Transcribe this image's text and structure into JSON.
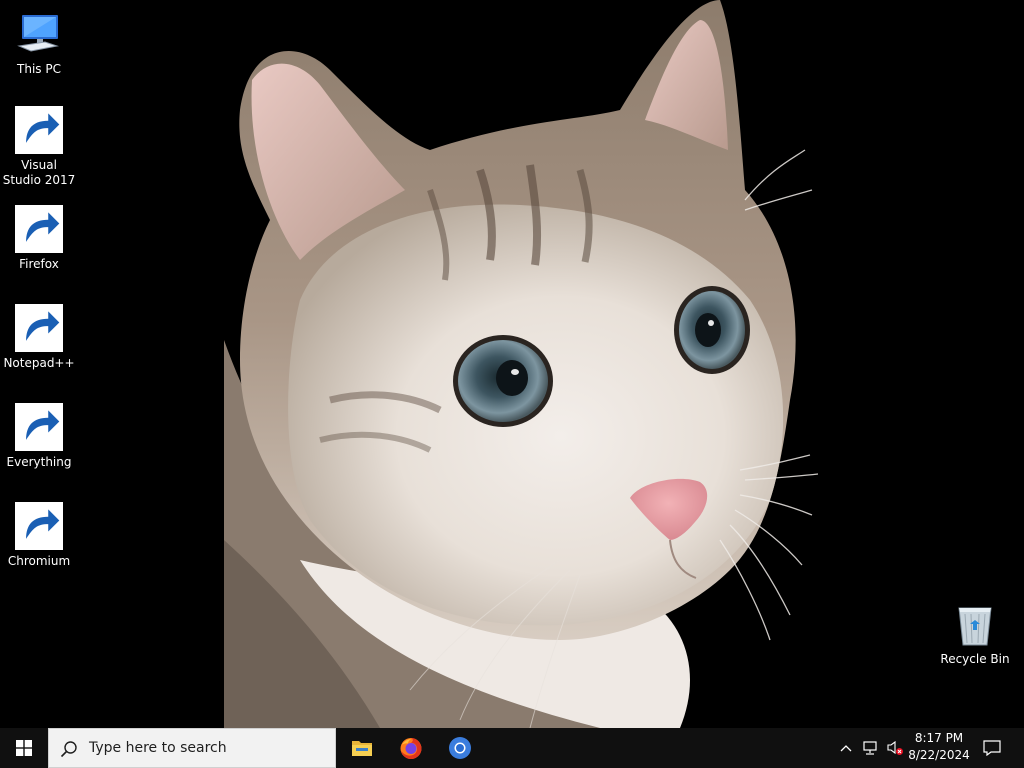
{
  "desktop": {
    "icons": [
      {
        "label": "This PC",
        "icon": "computer-icon"
      },
      {
        "label": "Visual Studio 2017",
        "icon": "visual-studio-icon"
      },
      {
        "label": "Firefox",
        "icon": "firefox-icon"
      },
      {
        "label": "Notepad++",
        "icon": "notepadpp-icon"
      },
      {
        "label": "Everything",
        "icon": "everything-icon"
      },
      {
        "label": "Chromium",
        "icon": "chromium-icon"
      },
      {
        "label": "Recycle Bin",
        "icon": "recycle-bin-icon"
      }
    ],
    "wallpaper": "cat-photo"
  },
  "taskbar": {
    "search": {
      "placeholder": "Type here to search"
    },
    "pinned": [
      {
        "name": "File Explorer",
        "icon": "file-explorer-icon"
      },
      {
        "name": "Firefox",
        "icon": "firefox-icon"
      },
      {
        "name": "Chromium",
        "icon": "chromium-icon"
      }
    ],
    "tray": {
      "time": "8:17 PM",
      "date": "8/22/2024"
    }
  },
  "colors": {
    "taskbar_bg": "#101010",
    "search_bg": "#f2f2f2",
    "desktop_bg": "#000000"
  }
}
